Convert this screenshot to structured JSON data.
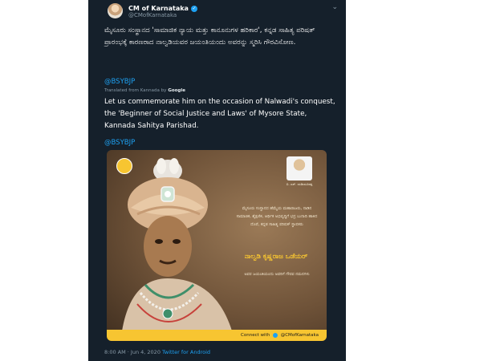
{
  "tweet": {
    "author_name": "CM of Karnataka",
    "author_handle": "@CMofKarnataka",
    "kannada_text": "ಮೈಸೂರು ಸಂಸ್ಥಾನದ 'ಸಾಮಾಜಿಕ ನ್ಯಾಯ ಮತ್ತು ಕಾನೂನುಗಳ ಹರಿಕಾರ', ಕನ್ನಡ ಸಾಹಿತ್ಯ ಪರಿಷತ್ ಪ್ರಾರಂಭಕ್ಕೆ ಕಾರಣರಾದ ನಾಲ್ವಡಿಯವರ ಜಯಂತಿಯಂದು ಅವರನ್ನು ಸ್ಮರಿಸಿ ಗೌರವಿಸೋಣ.",
    "mention_1": "@BSYBJP",
    "translated_label": "Translated from Kannada by",
    "translated_by": "Google",
    "english_text": "Let us commemorate him on the occasion of Nalwadi's conquest, the 'Beginner of Social Justice and Laws' of Mysore State, Kannada Sahitya Parishad.",
    "mention_2": "@BSYBJP",
    "timestamp": "8:00 AM · Jun 4, 2020",
    "source": "Twitter for Android"
  },
  "poster": {
    "text_block": "ಮೈಸೂರು ಸಂಸ್ಥಾನದ ಹೆಮ್ಮೆಯ ಮಹಾರಾಜರು, ನಾಡಿನ ಸಾಮಾಜಿಕ, ಶೈಕ್ಷಣಿಕ, ಆರ್ಥಿಕ ಅಭಿವೃದ್ಧಿಗೆ ಭದ್ರ ಬುನಾದಿ ಹಾಕಿದ ದೊರೆ, ಕನ್ನಡ ಸಾಹಿತ್ಯ ಪರಿಷತ್ ಸ್ಥಾಪಕರು",
    "king_name": "ನಾಲ್ವಡಿ ಕೃಷ್ಣರಾಜ ಒಡೆಯರ್",
    "text_block_2": "ಅವರ ಜಯಂತಿಯಂದು ಅವರಿಗೆ ಗೌರವ ನಮನಗಳು",
    "cm_caption": "ಬಿ. ಎಸ್. ಯಡಿಯೂರಪ್ಪ",
    "connect_label": "Connect with",
    "connect_handle": "@CMofKarnataka"
  }
}
